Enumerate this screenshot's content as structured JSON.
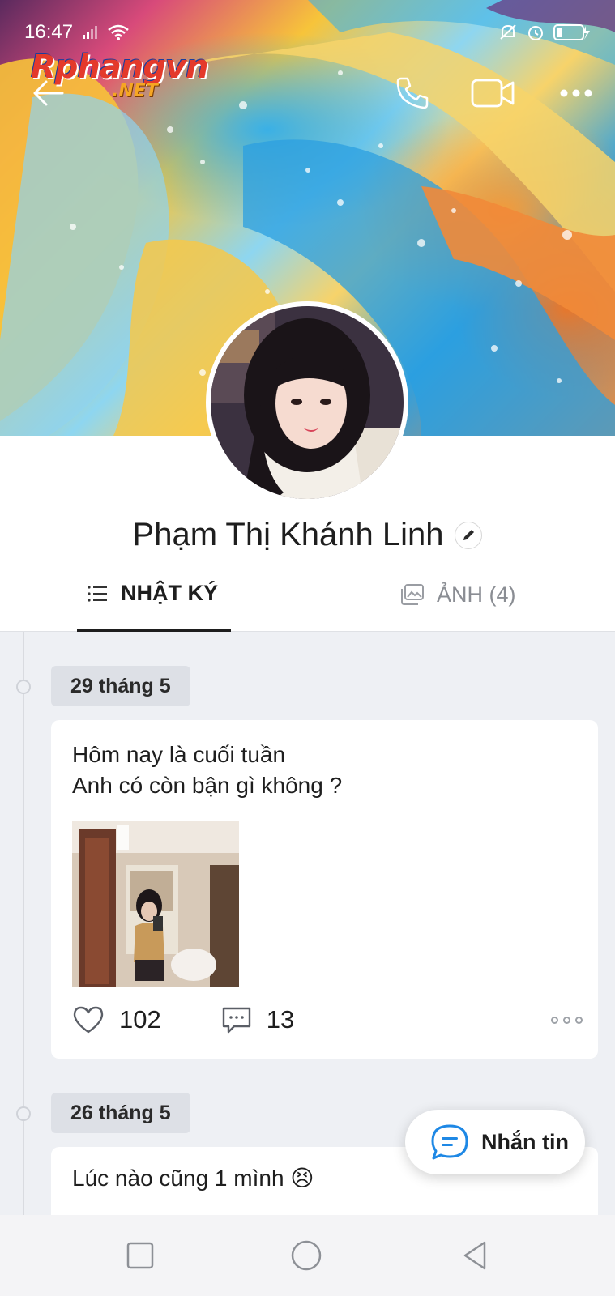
{
  "status_bar": {
    "time": "16:47",
    "icons": [
      "signal-icon",
      "wifi-icon",
      "mute-icon",
      "alarm-icon",
      "battery-charging-icon"
    ]
  },
  "watermark": {
    "main": "Rphangvn",
    "sub": ".NET"
  },
  "topbar": {
    "icons": [
      "back-arrow-icon",
      "phone-icon",
      "video-call-icon",
      "more-icon"
    ]
  },
  "profile": {
    "name": "Phạm Thị Khánh Linh"
  },
  "tabs": [
    {
      "label": "NHẬT KÝ",
      "icon": "list-icon",
      "active": true
    },
    {
      "label": "ẢNH (4)",
      "icon": "gallery-icon",
      "active": false
    }
  ],
  "posts": [
    {
      "date": "29 tháng 5",
      "text": "Hôm nay là cuối tuần\nAnh có còn bận gì không ?",
      "likes": "102",
      "comments": "13"
    },
    {
      "date": "26 tháng 5",
      "text": "Lúc nào cũng 1 mình 😣"
    }
  ],
  "message_button": {
    "label": "Nhắn tin"
  },
  "colors": {
    "accent": "#1e88e5",
    "background": "#eef0f4",
    "chip": "#dde0e6"
  }
}
